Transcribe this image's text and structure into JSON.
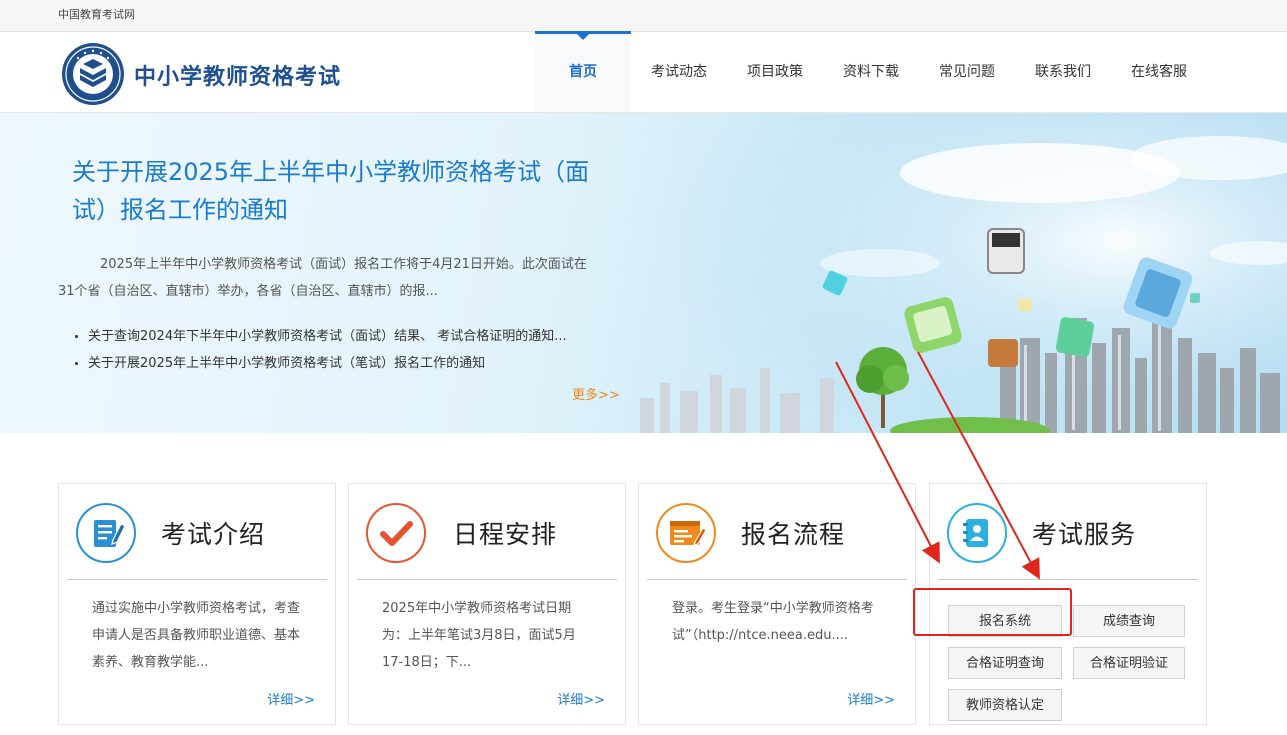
{
  "topbar": {
    "site_name": "中国教育考试网"
  },
  "header": {
    "logo_text": "中小学教师资格考试",
    "nav": [
      {
        "label": "首页",
        "active": true
      },
      {
        "label": "考试动态"
      },
      {
        "label": "项目政策"
      },
      {
        "label": "资料下载"
      },
      {
        "label": "常见问题"
      },
      {
        "label": "联系我们"
      },
      {
        "label": "在线客服"
      }
    ]
  },
  "banner": {
    "title": "关于开展2025年上半年中小学教师资格考试（面试）报名工作的通知",
    "description": "2025年上半年中小学教师资格考试（面试）报名工作将于4月21日开始。此次面试在31个省（自治区、直辖市）举办，各省（自治区、直辖市）的报...",
    "news": [
      "关于查询2024年下半年中小学教师资格考试（面试）结果、 考试合格证明的通知...",
      "关于开展2025年上半年中小学教师资格考试（笔试）报名工作的通知"
    ],
    "more": "更多>>"
  },
  "cards": [
    {
      "title": "考试介绍",
      "icon": "document-edit-icon",
      "text": "通过实施中小学教师资格考试，考查申请人是否具备教师职业道德、基本素养、教育教学能...",
      "link": "详细>>",
      "color": "#2b8fd6"
    },
    {
      "title": "日程安排",
      "icon": "checkmark-icon",
      "text": "2025年中小学教师资格考试日期为：上半年笔试3月8日，面试5月17-18日；下...",
      "link": "详细>>",
      "color": "#e8532f"
    },
    {
      "title": "报名流程",
      "icon": "web-form-icon",
      "text": "登录。考生登录“中小学教师资格考试”（http://ntce.neea.edu....",
      "link": "详细>>",
      "color": "#f08a1d"
    },
    {
      "title": "考试服务",
      "icon": "address-book-icon",
      "color": "#2baee0",
      "buttons": {
        "registration": "报名系统",
        "score_query": "成绩查询",
        "cert_query": "合格证明查询",
        "cert_verify": "合格证明验证",
        "qualification": "教师资格认定"
      }
    }
  ]
}
